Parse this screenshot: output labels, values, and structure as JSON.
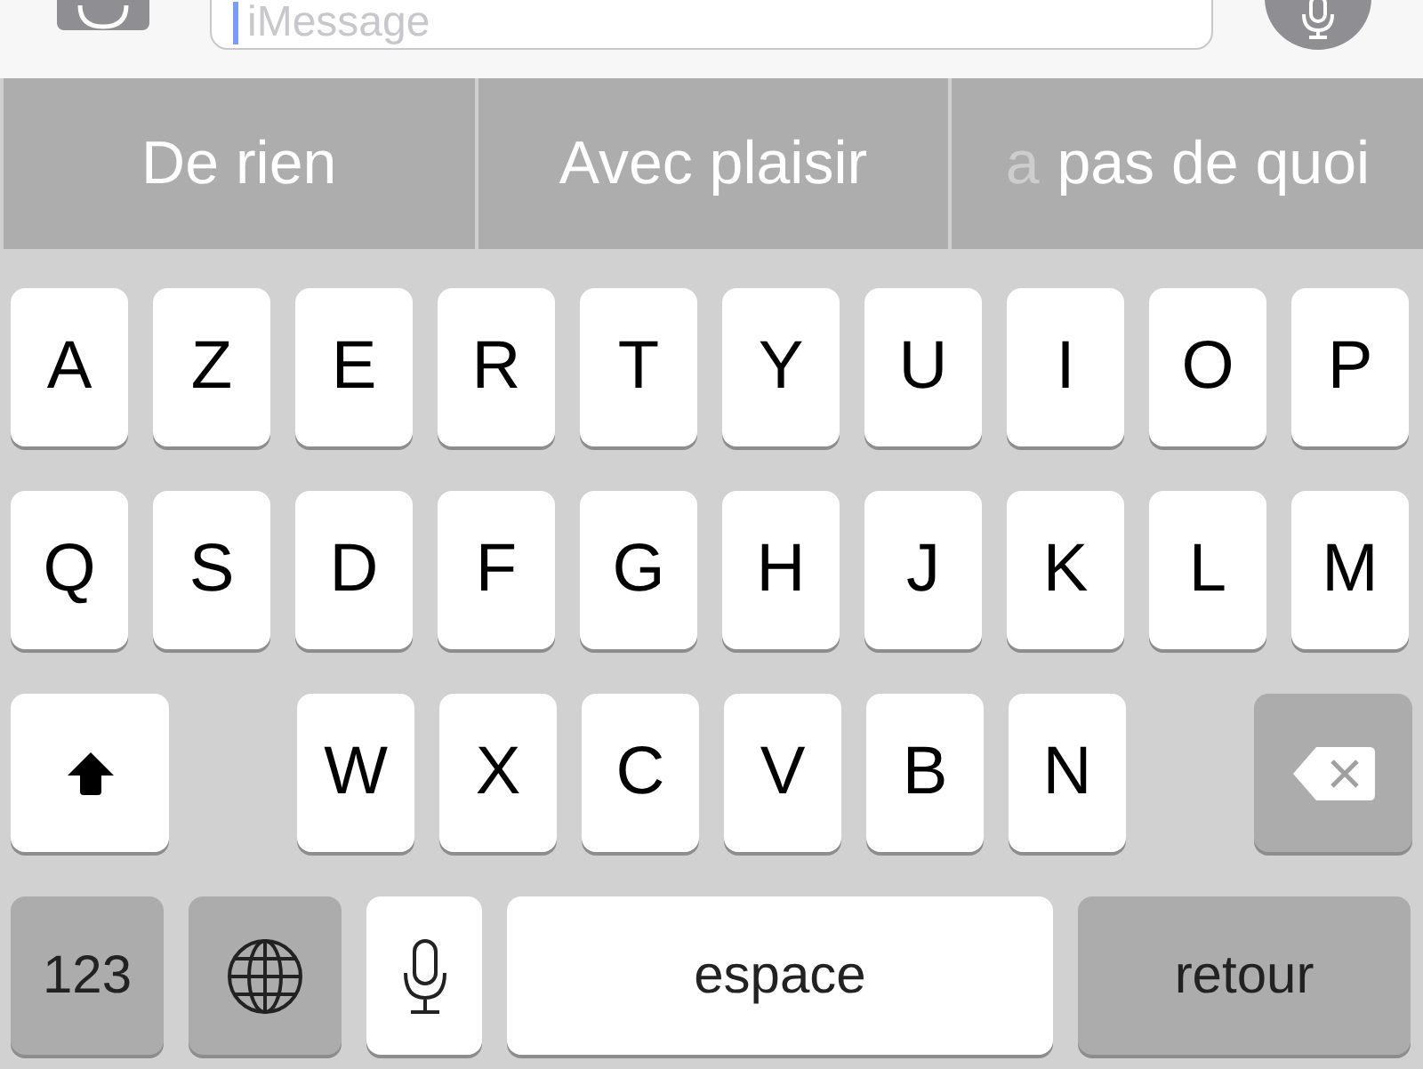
{
  "message_bar": {
    "placeholder": "iMessage"
  },
  "suggestions": [
    {
      "text": "De rien"
    },
    {
      "text": "Avec plaisir"
    },
    {
      "faded_prefix": "a",
      "text": "pas de quoi"
    }
  ],
  "keyboard": {
    "rows": [
      {
        "keys": [
          {
            "kind": "letter",
            "label": "A"
          },
          {
            "kind": "letter",
            "label": "Z"
          },
          {
            "kind": "letter",
            "label": "E"
          },
          {
            "kind": "letter",
            "label": "R"
          },
          {
            "kind": "letter",
            "label": "T"
          },
          {
            "kind": "letter",
            "label": "Y"
          },
          {
            "kind": "letter",
            "label": "U"
          },
          {
            "kind": "letter",
            "label": "I"
          },
          {
            "kind": "letter",
            "label": "O"
          },
          {
            "kind": "letter",
            "label": "P"
          }
        ]
      },
      {
        "keys": [
          {
            "kind": "letter",
            "label": "Q"
          },
          {
            "kind": "letter",
            "label": "S"
          },
          {
            "kind": "letter",
            "label": "D"
          },
          {
            "kind": "letter",
            "label": "F"
          },
          {
            "kind": "letter",
            "label": "G"
          },
          {
            "kind": "letter",
            "label": "H"
          },
          {
            "kind": "letter",
            "label": "J"
          },
          {
            "kind": "letter",
            "label": "K"
          },
          {
            "kind": "letter",
            "label": "L"
          },
          {
            "kind": "letter",
            "label": "M"
          }
        ]
      },
      {
        "keys": [
          {
            "kind": "shift",
            "on": true
          },
          {
            "kind": "letter",
            "label": "W"
          },
          {
            "kind": "letter",
            "label": "X"
          },
          {
            "kind": "letter",
            "label": "C"
          },
          {
            "kind": "letter",
            "label": "V"
          },
          {
            "kind": "letter",
            "label": "B"
          },
          {
            "kind": "letter",
            "label": "N"
          },
          {
            "kind": "delete"
          }
        ]
      },
      {
        "keys": [
          {
            "kind": "numbers",
            "label": "123"
          },
          {
            "kind": "globe"
          },
          {
            "kind": "mic"
          },
          {
            "kind": "space",
            "label": "espace"
          },
          {
            "kind": "return",
            "label": "retour"
          }
        ]
      }
    ]
  }
}
